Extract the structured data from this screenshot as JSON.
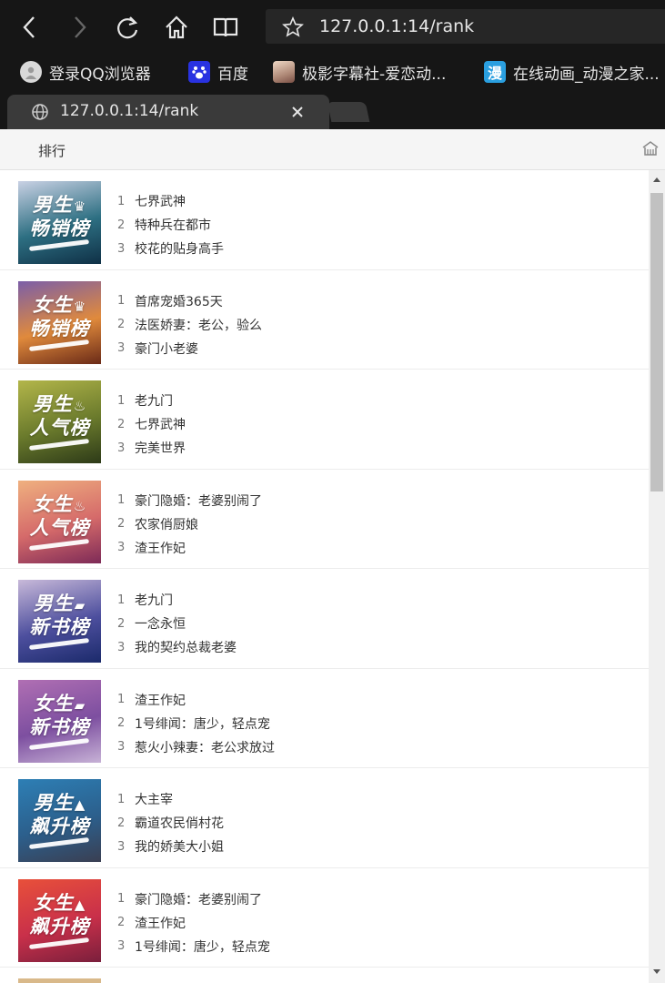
{
  "toolbar": {
    "back_icon": "chevron-left-icon",
    "forward_icon": "chevron-right-icon",
    "reload_icon": "reload-icon",
    "home_icon": "home-icon",
    "reader_icon": "book-icon",
    "address": "127.0.0.1:14/rank"
  },
  "bookmarks": [
    {
      "label": "登录QQ浏览器",
      "icon": "user-avatar-icon",
      "color": "#d9d9d9"
    },
    {
      "label": "百度",
      "icon": "baidu-paw-icon",
      "color": "#2932e1"
    },
    {
      "label": "极影字幕社-爱恋动...",
      "icon": "anime-avatar-icon",
      "color": "#b08a78"
    },
    {
      "label": "在线动画_动漫之家...",
      "icon": "man-logo-icon",
      "color": "#2a9fe0"
    }
  ],
  "tab": {
    "title": "127.0.0.1:14/rank"
  },
  "page": {
    "title": "排行"
  },
  "rankings": [
    {
      "name": "男生畅销榜",
      "line1": "男生",
      "line2": "畅销榜",
      "badge": "♛",
      "colors": [
        "#c9d1e4",
        "#2d6f82",
        "#0f3046"
      ],
      "books": [
        {
          "rank": "1",
          "title": "七界武神"
        },
        {
          "rank": "2",
          "title": "特种兵在都市"
        },
        {
          "rank": "3",
          "title": "校花的贴身高手"
        }
      ]
    },
    {
      "name": "女生畅销榜",
      "line1": "女生",
      "line2": "畅销榜",
      "badge": "♛",
      "colors": [
        "#7b5ea8",
        "#e08a3c",
        "#6a2a17"
      ],
      "books": [
        {
          "rank": "1",
          "title": "首席宠婚365天"
        },
        {
          "rank": "2",
          "title": "法医娇妻：老公，验么"
        },
        {
          "rank": "3",
          "title": "豪门小老婆"
        }
      ]
    },
    {
      "name": "男生人气榜",
      "line1": "男生",
      "line2": "人气榜",
      "badge": "♨",
      "colors": [
        "#b3b64a",
        "#6a7a2c",
        "#2d3a18"
      ],
      "books": [
        {
          "rank": "1",
          "title": "老九门"
        },
        {
          "rank": "2",
          "title": "七界武神"
        },
        {
          "rank": "3",
          "title": "完美世界"
        }
      ]
    },
    {
      "name": "女生人气榜",
      "line1": "女生",
      "line2": "人气榜",
      "badge": "♨",
      "colors": [
        "#efb07f",
        "#d56a6a",
        "#7d2a57"
      ],
      "books": [
        {
          "rank": "1",
          "title": "豪门隐婚：老婆别闹了"
        },
        {
          "rank": "2",
          "title": "农家俏厨娘"
        },
        {
          "rank": "3",
          "title": "渣王作妃"
        }
      ]
    },
    {
      "name": "男生新书榜",
      "line1": "男生",
      "line2": "新书榜",
      "badge": "▰",
      "colors": [
        "#c8b9d9",
        "#4d4f9e",
        "#1b2a6b"
      ],
      "books": [
        {
          "rank": "1",
          "title": "老九门"
        },
        {
          "rank": "2",
          "title": "一念永恒"
        },
        {
          "rank": "3",
          "title": "我的契约总裁老婆"
        }
      ]
    },
    {
      "name": "女生新书榜",
      "line1": "女生",
      "line2": "新书榜",
      "badge": "▰",
      "colors": [
        "#b06fb3",
        "#7d4fa0",
        "#c7b2d6"
      ],
      "books": [
        {
          "rank": "1",
          "title": "渣王作妃"
        },
        {
          "rank": "2",
          "title": "1号绯闻：唐少，轻点宠"
        },
        {
          "rank": "3",
          "title": "惹火小辣妻：老公求放过"
        }
      ]
    },
    {
      "name": "男生飙升榜",
      "line1": "男生",
      "line2": "飙升榜",
      "badge": "▲",
      "colors": [
        "#2d7fb5",
        "#2c5f8c",
        "#3a3f52"
      ],
      "books": [
        {
          "rank": "1",
          "title": "大主宰"
        },
        {
          "rank": "2",
          "title": "霸道农民俏村花"
        },
        {
          "rank": "3",
          "title": "我的娇美大小姐"
        }
      ]
    },
    {
      "name": "女生飙升榜",
      "line1": "女生",
      "line2": "飙升榜",
      "badge": "▲",
      "colors": [
        "#e8503a",
        "#c9304a",
        "#7a1f3c"
      ],
      "books": [
        {
          "rank": "1",
          "title": "豪门隐婚：老婆别闹了"
        },
        {
          "rank": "2",
          "title": "渣王作妃"
        },
        {
          "rank": "3",
          "title": "1号绯闻：唐少，轻点宠"
        }
      ]
    }
  ]
}
